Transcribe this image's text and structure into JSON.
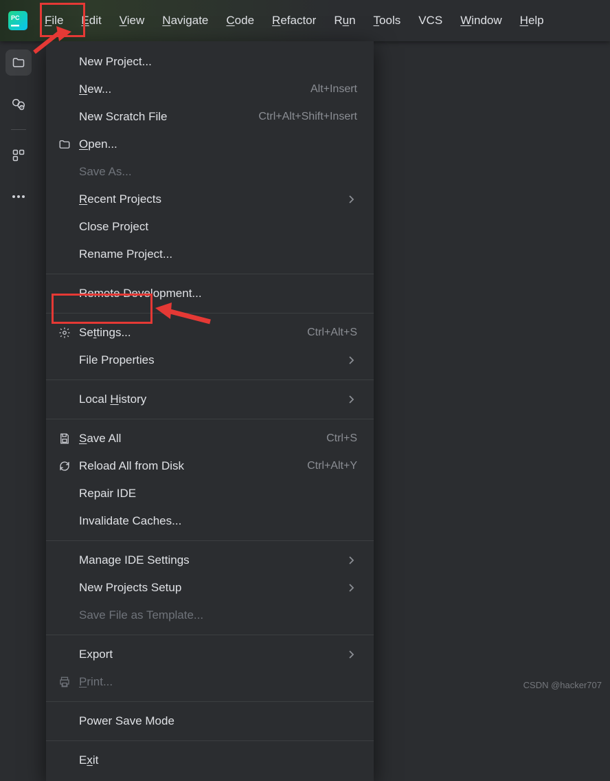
{
  "menubar": {
    "items": [
      {
        "label": "File",
        "mn": "F",
        "rest": "ile"
      },
      {
        "label": "Edit",
        "mn": "E",
        "rest": "dit"
      },
      {
        "label": "View",
        "mn": "V",
        "rest": "iew"
      },
      {
        "label": "Navigate",
        "mn": "N",
        "rest": "avigate"
      },
      {
        "label": "Code",
        "mn": "C",
        "rest": "ode"
      },
      {
        "label": "Refactor",
        "mn": "R",
        "rest": "efactor"
      },
      {
        "label": "Run",
        "pre": "R",
        "mn": "u",
        "rest": "n"
      },
      {
        "label": "Tools",
        "mn": "T",
        "rest": "ools"
      },
      {
        "label": "VCS",
        "plain": "VCS"
      },
      {
        "label": "Window",
        "mn": "W",
        "rest": "indow"
      },
      {
        "label": "Help",
        "mn": "H",
        "rest": "elp"
      }
    ]
  },
  "file_menu": {
    "groups": [
      [
        {
          "label": "New Project..."
        },
        {
          "label": "New...",
          "mn": "N",
          "rest": "ew...",
          "shortcut": "Alt+Insert"
        },
        {
          "label": "New Scratch File",
          "shortcut": "Ctrl+Alt+Shift+Insert"
        },
        {
          "label": "Open...",
          "mn": "O",
          "rest": "pen...",
          "icon": "folder"
        },
        {
          "label": "Save As...",
          "disabled": true
        },
        {
          "label": "Recent Projects",
          "mn": "R",
          "rest": "ecent Projects",
          "submenu": true
        },
        {
          "label": "Close Project"
        },
        {
          "label": "Rename Project..."
        }
      ],
      [
        {
          "label": "Remote Development..."
        }
      ],
      [
        {
          "label": "Settings...",
          "pre": "Se",
          "mn": "t",
          "rest": "tings...",
          "shortcut": "Ctrl+Alt+S",
          "icon": "gear",
          "highlight": true
        },
        {
          "label": "File Properties",
          "submenu": true
        }
      ],
      [
        {
          "label": "Local History",
          "pre": "Local ",
          "mn": "H",
          "rest": "istory",
          "submenu": true
        }
      ],
      [
        {
          "label": "Save All",
          "mn": "S",
          "rest": "ave All",
          "shortcut": "Ctrl+S",
          "icon": "save"
        },
        {
          "label": "Reload All from Disk",
          "shortcut": "Ctrl+Alt+Y",
          "icon": "reload"
        },
        {
          "label": "Repair IDE"
        },
        {
          "label": "Invalidate Caches..."
        }
      ],
      [
        {
          "label": "Manage IDE Settings",
          "submenu": true
        },
        {
          "label": "New Projects Setup",
          "submenu": true
        },
        {
          "label": "Save File as Template...",
          "disabled": true
        }
      ],
      [
        {
          "label": "Export",
          "submenu": true
        },
        {
          "label": "Print...",
          "mn": "P",
          "rest": "rint...",
          "disabled": true,
          "icon": "print"
        }
      ],
      [
        {
          "label": "Power Save Mode"
        }
      ],
      [
        {
          "label": "Exit",
          "pre": "E",
          "mn": "x",
          "rest": "it"
        }
      ]
    ]
  },
  "watermark": "CSDN @hacker707"
}
